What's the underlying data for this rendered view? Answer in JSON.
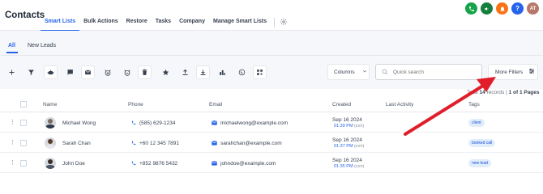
{
  "header": {
    "title": "Contacts",
    "nav": [
      "Smart Lists",
      "Bulk Actions",
      "Restore",
      "Tasks",
      "Company",
      "Manage Smart Lists"
    ],
    "avatar_initials": "AT",
    "icon_colors": {
      "phone": "#16a34a",
      "megaphone": "#15803d",
      "bell": "#f97316",
      "help": "#2563eb",
      "avatar": "#b7776a"
    }
  },
  "subtabs": [
    "All",
    "New Leads"
  ],
  "toolbar": {
    "icons": [
      "plus-icon",
      "filter-icon",
      "robot-icon",
      "message-icon",
      "email-icon",
      "alarm-add-icon",
      "alarm-remove-icon",
      "trash-icon",
      "star-icon",
      "upload-icon",
      "download-icon",
      "merge-icon",
      "whatsapp-icon",
      "qr-icon"
    ],
    "columns_label": "Columns",
    "search_placeholder": "Quick search",
    "more_filters_label": "More Filters"
  },
  "records": {
    "prefix": "Total",
    "count": "14",
    "suffix": "records |",
    "page": "1 of 1 Pages"
  },
  "table": {
    "columns": [
      "Name",
      "Phone",
      "Email",
      "Created",
      "Last Activity",
      "Tags"
    ],
    "rows": [
      {
        "name": "Michael Wong",
        "phone": "(585) 629-1234",
        "email": "michaelwong@example.com",
        "date": "Sep 16 2024",
        "time": "01:39 PM",
        "tz": "(CST)",
        "tag": "client"
      },
      {
        "name": "Sarah Chan",
        "phone": "+60 12 345 7891",
        "email": "sarahchan@example.com",
        "date": "Sep 16 2024",
        "time": "01:37 PM",
        "tz": "(CST)",
        "tag": "booked call"
      },
      {
        "name": "John Doe",
        "phone": "+852 9876 5432",
        "email": "johndoe@example.com",
        "date": "Sep 16 2024",
        "time": "01:35 PM",
        "tz": "(CST)",
        "tag": "new lead"
      }
    ]
  },
  "annotation": {
    "arrow_color": "#e11d2a"
  }
}
